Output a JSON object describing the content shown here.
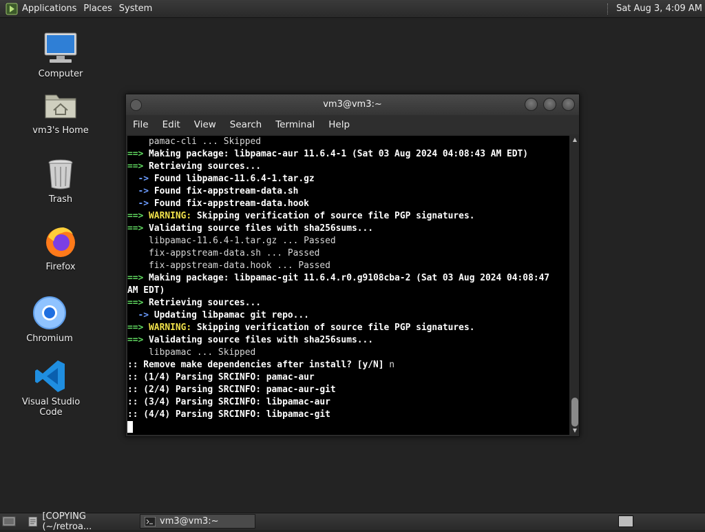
{
  "top_panel": {
    "menus": [
      "Applications",
      "Places",
      "System"
    ],
    "clock": "Sat Aug  3,  4:09 AM"
  },
  "desktop": {
    "icons": [
      {
        "label": "Computer",
        "icon": "computer-icon"
      },
      {
        "label": "vm3's Home",
        "icon": "home-folder-icon"
      },
      {
        "label": "Trash",
        "icon": "trash-icon"
      },
      {
        "label": "Firefox",
        "icon": "firefox-icon"
      },
      {
        "label": "Chromium",
        "icon": "chromium-icon"
      },
      {
        "label": "Visual Studio Code",
        "icon": "vscode-icon"
      }
    ]
  },
  "terminal": {
    "title": "vm3@vm3:~",
    "menu": [
      "File",
      "Edit",
      "View",
      "Search",
      "Terminal",
      "Help"
    ],
    "lines": [
      [
        {
          "t": "    pamac-cli ... Skipped",
          "c": ""
        }
      ],
      [
        {
          "t": "==> ",
          "c": "g"
        },
        {
          "t": "Making package: libpamac-aur 11.6.4-1 (Sat 03 Aug 2024 04:08:43 AM EDT)",
          "c": "w"
        }
      ],
      [
        {
          "t": "==> ",
          "c": "g"
        },
        {
          "t": "Retrieving sources...",
          "c": "w"
        }
      ],
      [
        {
          "t": "  -> ",
          "c": "b"
        },
        {
          "t": "Found libpamac-11.6.4-1.tar.gz",
          "c": "w"
        }
      ],
      [
        {
          "t": "  -> ",
          "c": "b"
        },
        {
          "t": "Found fix-appstream-data.sh",
          "c": "w"
        }
      ],
      [
        {
          "t": "  -> ",
          "c": "b"
        },
        {
          "t": "Found fix-appstream-data.hook",
          "c": "w"
        }
      ],
      [
        {
          "t": "==> ",
          "c": "g"
        },
        {
          "t": "WARNING:",
          "c": "y"
        },
        {
          "t": " Skipping verification of source file PGP signatures.",
          "c": "w"
        }
      ],
      [
        {
          "t": "==> ",
          "c": "g"
        },
        {
          "t": "Validating source files with sha256sums...",
          "c": "w"
        }
      ],
      [
        {
          "t": "    libpamac-11.6.4-1.tar.gz ... Passed",
          "c": ""
        }
      ],
      [
        {
          "t": "    fix-appstream-data.sh ... Passed",
          "c": ""
        }
      ],
      [
        {
          "t": "    fix-appstream-data.hook ... Passed",
          "c": ""
        }
      ],
      [
        {
          "t": "==> ",
          "c": "g"
        },
        {
          "t": "Making package: libpamac-git 11.6.4.r0.g9108cba-2 (Sat 03 Aug 2024 04:08:47",
          "c": "w"
        }
      ],
      [
        {
          "t": "AM EDT)",
          "c": "w"
        }
      ],
      [
        {
          "t": "==> ",
          "c": "g"
        },
        {
          "t": "Retrieving sources...",
          "c": "w"
        }
      ],
      [
        {
          "t": "  -> ",
          "c": "b"
        },
        {
          "t": "Updating libpamac git repo...",
          "c": "w"
        }
      ],
      [
        {
          "t": "==> ",
          "c": "g"
        },
        {
          "t": "WARNING:",
          "c": "y"
        },
        {
          "t": " Skipping verification of source file PGP signatures.",
          "c": "w"
        }
      ],
      [
        {
          "t": "==> ",
          "c": "g"
        },
        {
          "t": "Validating source files with sha256sums...",
          "c": "w"
        }
      ],
      [
        {
          "t": "    libpamac ... Skipped",
          "c": ""
        }
      ],
      [
        {
          "t": ":: Remove make dependencies after install? [y/N] ",
          "c": "w"
        },
        {
          "t": "n",
          "c": ""
        }
      ],
      [
        {
          "t": ":: (1/4) Parsing SRCINFO: pamac-aur",
          "c": "w"
        }
      ],
      [
        {
          "t": ":: (2/4) Parsing SRCINFO: pamac-aur-git",
          "c": "w"
        }
      ],
      [
        {
          "t": ":: (3/4) Parsing SRCINFO: libpamac-aur",
          "c": "w"
        }
      ],
      [
        {
          "t": ":: (4/4) Parsing SRCINFO: libpamac-git",
          "c": "w"
        }
      ]
    ]
  },
  "bottom_panel": {
    "tasks": [
      {
        "label": "[COPYING (~/retroa...",
        "icon": "text-editor-icon"
      },
      {
        "label": "vm3@vm3:~",
        "icon": "terminal-icon"
      }
    ]
  },
  "colors": {
    "arrow_green": "#5fd75f",
    "arrow_blue": "#6c9cff",
    "warning_yellow": "#f0e14a"
  }
}
